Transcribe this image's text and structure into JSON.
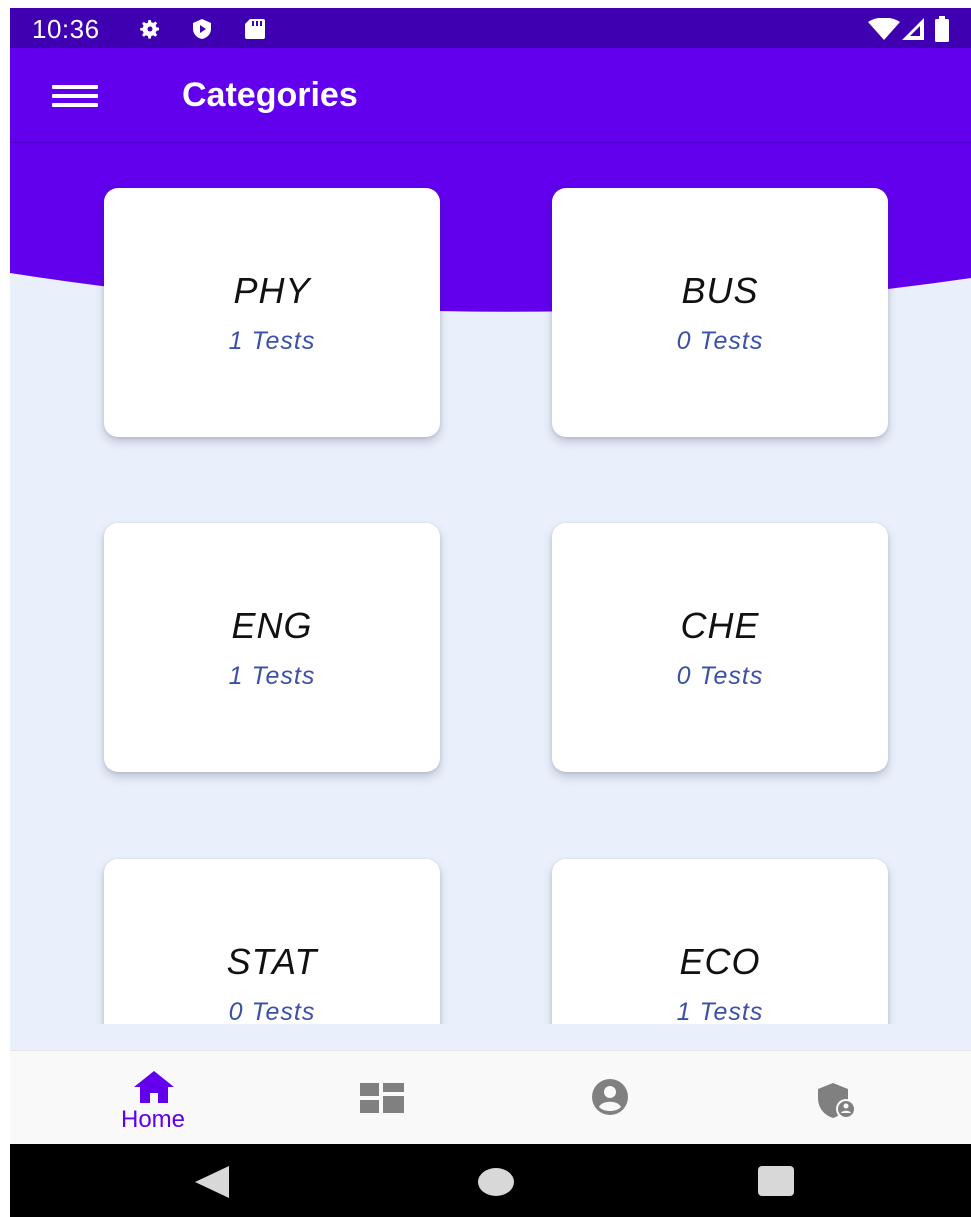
{
  "status_bar": {
    "time": "10:36",
    "icons": [
      "gear-icon",
      "shield-play-icon",
      "sd-card-icon",
      "wifi-icon",
      "signal-icon",
      "battery-icon"
    ]
  },
  "app_bar": {
    "title": "Categories",
    "menu_icon": "hamburger-menu-icon"
  },
  "theme": {
    "primary": "#6200ee",
    "status_bar": "#3f00b2",
    "background": "#eaf0fb",
    "card": "#ffffff",
    "subtitle": "#3b50a8",
    "nav_inactive": "#808080"
  },
  "categories": [
    {
      "name": "PHY",
      "tests": "1 Tests"
    },
    {
      "name": "BUS",
      "tests": "0 Tests"
    },
    {
      "name": "ENG",
      "tests": "1 Tests"
    },
    {
      "name": "CHE",
      "tests": "0 Tests"
    },
    {
      "name": "STAT",
      "tests": "0 Tests"
    },
    {
      "name": "ECO",
      "tests": "1 Tests"
    }
  ],
  "bottom_nav": {
    "items": [
      {
        "icon": "home-icon",
        "label": "Home",
        "active": true
      },
      {
        "icon": "dashboard-icon",
        "label": "",
        "active": false
      },
      {
        "icon": "account-circle-icon",
        "label": "",
        "active": false
      },
      {
        "icon": "admin-shield-icon",
        "label": "",
        "active": false
      }
    ]
  },
  "system_nav": {
    "icons": [
      "back-triangle-icon",
      "home-circle-icon",
      "recents-square-icon"
    ]
  }
}
